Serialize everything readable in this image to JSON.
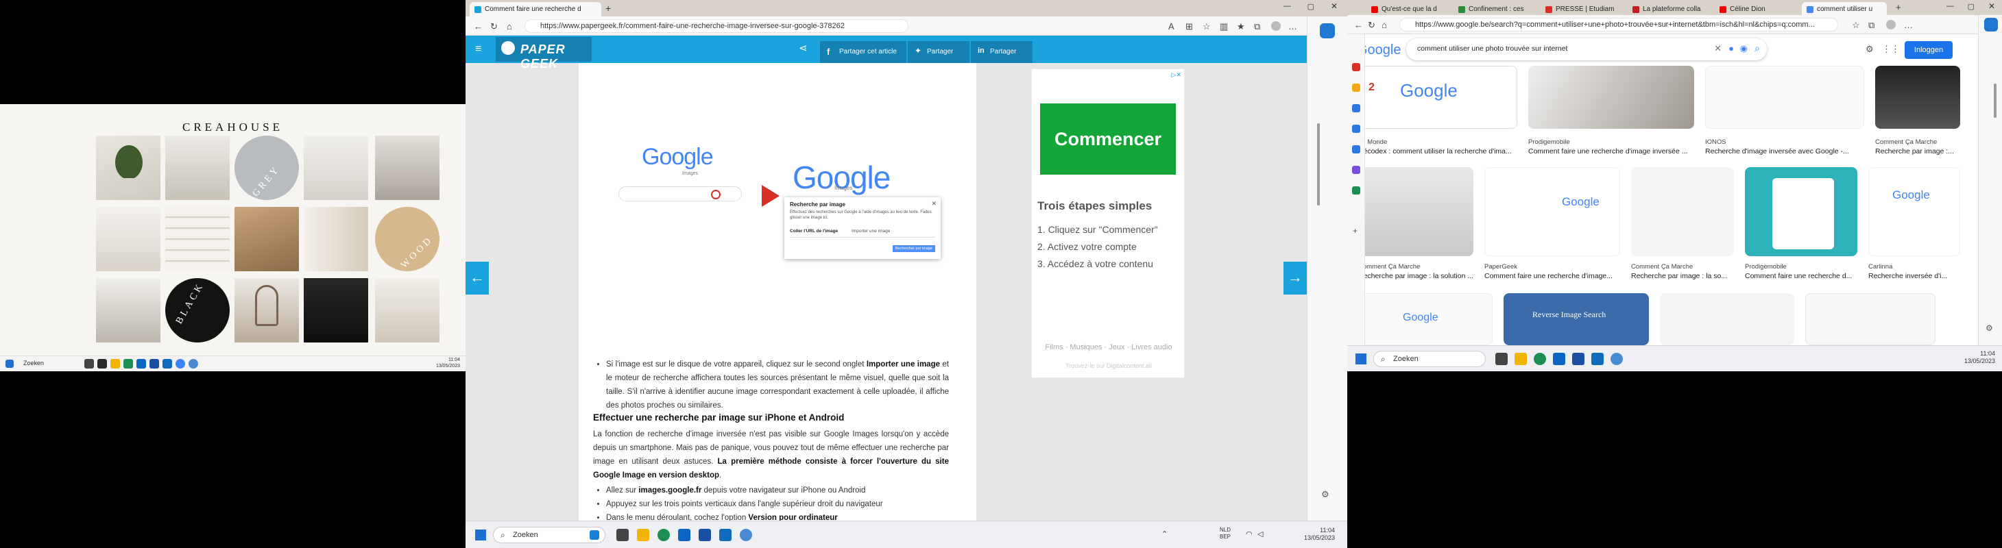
{
  "screen_left": {
    "brand": "CREAHOUSE",
    "circle_labels": {
      "grey": "GREY",
      "wood": "WOOD",
      "black": "BLACK"
    },
    "colors": {
      "grey": "#b9bcbe",
      "wood": "#d5b88b",
      "black": "#141211"
    },
    "taskbar": {
      "search": "Zoeken",
      "time": "11:04",
      "date": "13/05/2023"
    }
  },
  "screen_middle": {
    "tabs": [
      {
        "label": "Comment faire une recherche d"
      }
    ],
    "url": "https://www.papergeek.fr/comment-faire-une-recherche-image-inversee-sur-google-378262",
    "logo": "PAPER GEEK",
    "share_buttons": {
      "facebook": "Partager cet article",
      "twitter": "Partager",
      "linkedin": "Partager"
    },
    "screenshot_figure": {
      "google_word": "Google",
      "images_word": "Images",
      "popup_title": "Recherche par image",
      "popup_desc": "Effectuez des recherches sur Google à l'aide d'images au lieu de texte. Faites glisser une image ici.",
      "popup_tab1": "Coller l'URL de l'image",
      "popup_tab2": "Importer une image",
      "popup_btn": "Rechercher par image"
    },
    "ad": {
      "cta": "Commencer",
      "title": "Trois étapes simples",
      "steps": [
        "1. Cliquez sur \"Commencer\"",
        "2. Activez votre compte",
        "3. Accédez à votre contenu"
      ],
      "categories": "Films · Musiques · Jeux · Livres audio",
      "footer": "Trouvez-le sur Digitalcontent.all"
    },
    "article": {
      "bullet1_pre": "Si l'image est sur le disque de votre appareil, cliquez sur le second onglet ",
      "bullet1_bold": "Importer une image",
      "bullet1_post": " et le moteur de recherche affichera toutes les sources présentant le même visuel, quelle que soit la taille. S'il n'arrive à identifier aucune image correspondant exactement à celle uploadée, il affiche des photos proches ou similaires.",
      "heading": "Effectuer une recherche par image sur iPhone et Android",
      "para_pre": "La fonction de recherche d'image inversée n'est pas visible sur Google Images lorsqu'on y accède depuis un smartphone. Mais pas de panique, vous pouvez tout de même effectuer une recherche par image en utilisant deux astuces. ",
      "para_bold": "La première méthode consiste à forcer l'ouverture du site Google Image en version desktop",
      "para_post": ".",
      "list": [
        {
          "pre": "Allez sur ",
          "bold": "images.google.fr",
          "post": " depuis votre navigateur sur iPhone ou Android"
        },
        {
          "pre": "Appuyez sur les trois points verticaux dans l'angle supérieur droit du navigateur",
          "bold": "",
          "post": ""
        },
        {
          "pre": "Dans le menu déroulant, cochez l'option ",
          "bold": "Version pour ordinateur",
          "post": ""
        }
      ]
    },
    "taskbar": {
      "search": "Zoeken",
      "lang": "NLD",
      "lang2": "BEP",
      "time": "11:04",
      "date": "13/05/2023"
    }
  },
  "screen_right": {
    "tabs": [
      {
        "label": "Qu'est-ce que la d"
      },
      {
        "label": "Confinement : ces"
      },
      {
        "label": "PRESSE | Etudiam"
      },
      {
        "label": "La plateforme colla"
      },
      {
        "label": "Céline Dion"
      },
      {
        "label": "comment utiliser u"
      }
    ],
    "url": "https://www.google.be/search?q=comment+utiliser+une+photo+trouvée+sur+internet&tbm=isch&hl=nl&chips=q:comm...",
    "query": "comment utiliser une photo trouvée sur internet",
    "login": "Inloggen",
    "results_row1": [
      {
        "source": "Le Monde",
        "caption": "Décodex : comment utiliser la recherche d'ima..."
      },
      {
        "source": "Prodigemobile",
        "caption": "Comment faire une recherche d'image inversée ..."
      },
      {
        "source": "IONOS",
        "caption": "Recherche d'image inversée avec Google -..."
      },
      {
        "source": "Comment Ça Marche",
        "caption": "Recherche par image :..."
      }
    ],
    "results_row2": [
      {
        "source": "Comment Ça Marche",
        "caption": "Recherche par image : la solution ..."
      },
      {
        "source": "PaperGeek",
        "caption": "Comment faire une recherche d'image..."
      },
      {
        "source": "Comment Ça Marche",
        "caption": "Recherche par image : la so..."
      },
      {
        "source": "Prodigemobile",
        "caption": "Comment faire une recherche d..."
      },
      {
        "source": "Carlinna",
        "caption": "Recherche inversée d'i..."
      }
    ],
    "thumb_misc": {
      "red_number": "2",
      "reverse_title": "Reverse Image Search"
    },
    "taskbar": {
      "search": "Zoeken",
      "time": "11:04",
      "date": "13/05/2023"
    }
  }
}
